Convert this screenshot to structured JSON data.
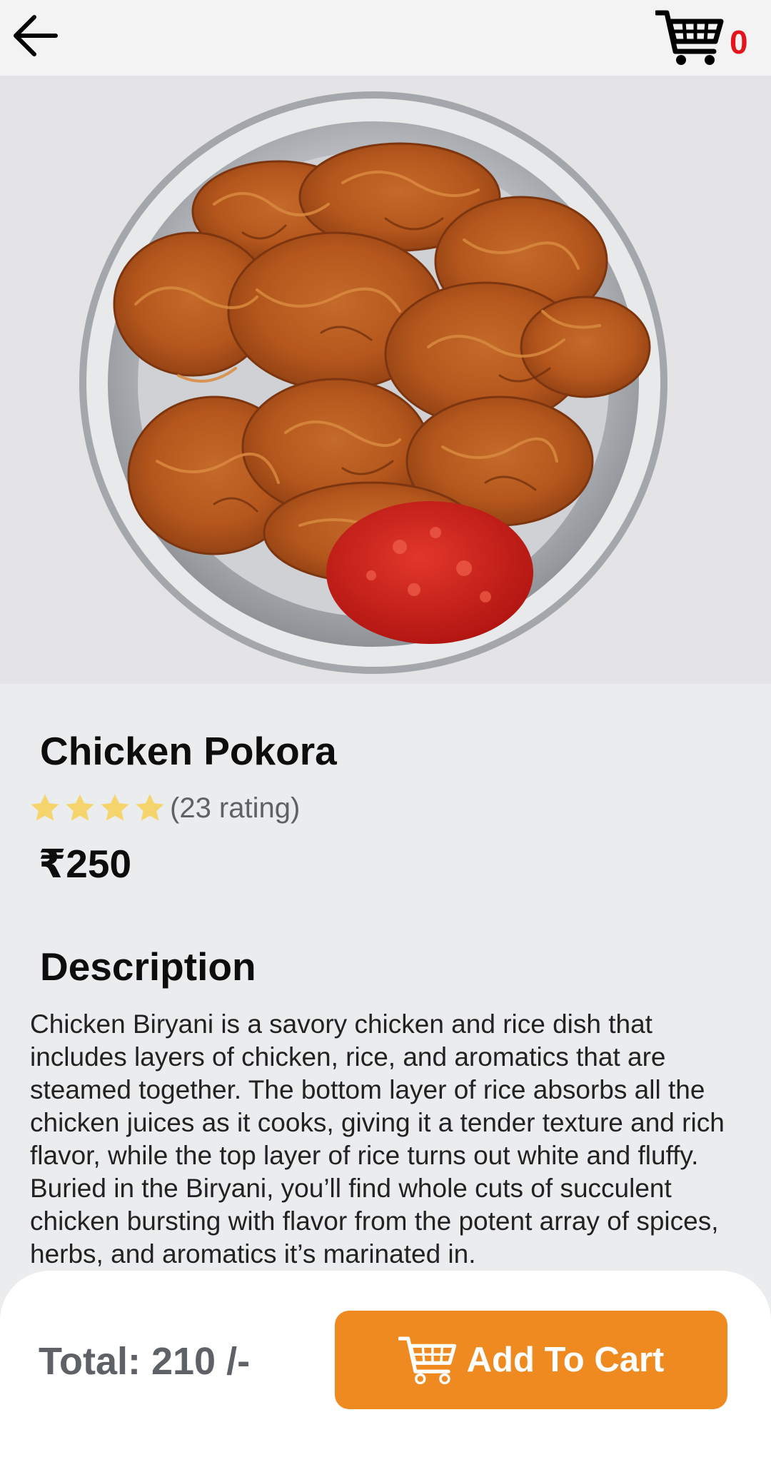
{
  "header": {
    "cart_count": "0",
    "cart_count_color": "#e3141c"
  },
  "product": {
    "name": "Chicken Pokora",
    "rating_stars": 4,
    "rating_text": "(23 rating)",
    "price": "₹250",
    "image": "fried-pakora-on-steel-plate-with-chutney"
  },
  "description": {
    "heading": "Description",
    "text": "Chicken Biryani is a savory chicken and rice dish that includes layers of chicken, rice, and aromatics that are steamed together. The bottom layer of rice absorbs all the chicken juices as it cooks, giving it a tender texture and rich flavor, while the top layer of rice turns out white and fluffy. Buried in the Biryani, you’ll find whole cuts of succulent chicken bursting with flavor from the potent array of spices, herbs, and aromatics it’s marinated in."
  },
  "footer": {
    "total_label": "Total: 210 /-",
    "add_to_cart_label": "Add To Cart",
    "accent_color": "#ef8a20"
  },
  "icons": [
    "back-arrow-icon",
    "shopping-cart-icon",
    "star-icon"
  ]
}
